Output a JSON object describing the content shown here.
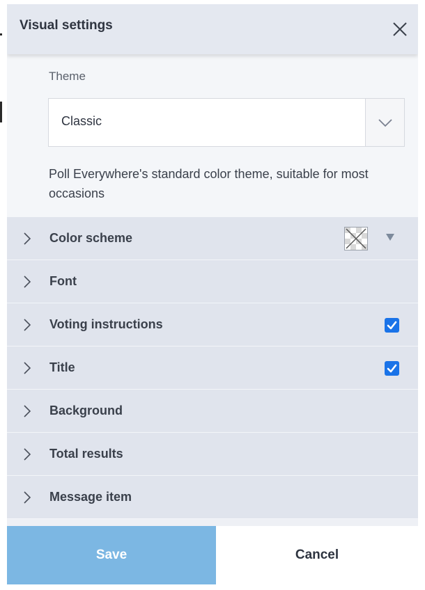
{
  "dialog": {
    "title": "Visual settings",
    "close_icon": "close-icon"
  },
  "theme": {
    "label": "Theme",
    "selected": "Classic",
    "description": "Poll Everywhere's standard color theme, suitable for most occasions"
  },
  "sections": [
    {
      "label": "Color scheme",
      "control": "swatch"
    },
    {
      "label": "Font",
      "control": "none"
    },
    {
      "label": "Voting instructions",
      "control": "checkbox",
      "checked": true
    },
    {
      "label": "Title",
      "control": "checkbox",
      "checked": true
    },
    {
      "label": "Background",
      "control": "none"
    },
    {
      "label": "Total results",
      "control": "none"
    },
    {
      "label": "Message item",
      "control": "none"
    }
  ],
  "footer": {
    "save_label": "Save",
    "cancel_label": "Cancel"
  },
  "colors": {
    "accent": "#1a73e8",
    "save_button": "#7cb7e3",
    "row_background": "#e0e4ed"
  }
}
